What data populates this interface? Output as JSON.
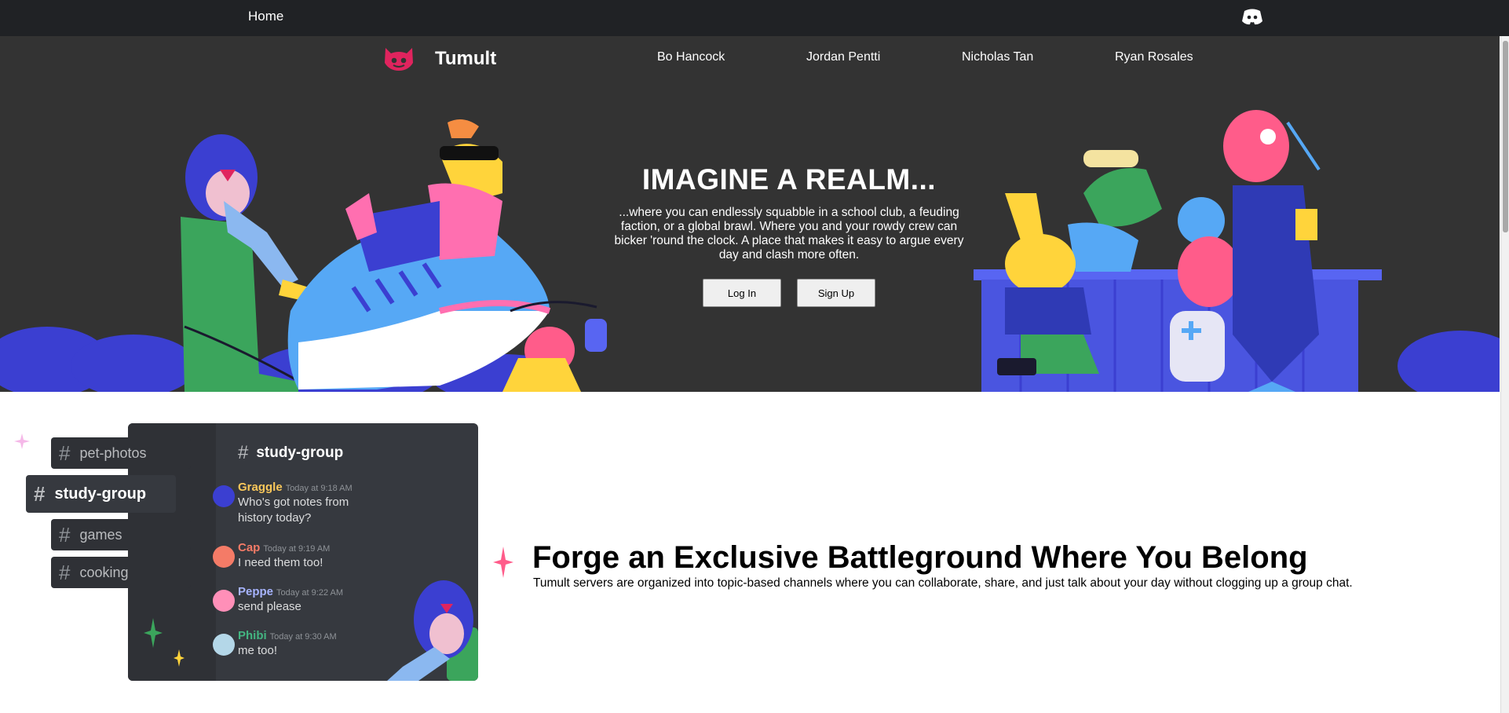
{
  "topbar": {
    "home_label": "Home",
    "right_icon": "discord-icon"
  },
  "brand": {
    "name": "Tumult",
    "logo_icon": "discord-logo-icon",
    "logo_color": "#e0245e"
  },
  "nav": {
    "links": [
      "Bo Hancock",
      "Jordan Pentti",
      "Nicholas Tan",
      "Ryan Rosales"
    ]
  },
  "hero": {
    "title": "IMAGINE A REALM...",
    "text": "...where you can endlessly squabble in a school club, a feuding faction, or a global brawl. Where you and your rowdy crew can bicker 'round the clock. A place that makes it easy to argue every day and clash more often.",
    "login_label": "Log In",
    "signup_label": "Sign Up",
    "background": "#333333",
    "accent_blue": "#5865f2"
  },
  "chat": {
    "channels": [
      "pet-photos",
      "study-group",
      "games",
      "cooking"
    ],
    "active_channel": "study-group",
    "header": "study-group",
    "messages": [
      {
        "name": "Graggle",
        "time": "Today at 9:18 AM",
        "text": "Who's got notes from history today?",
        "color": "#f9c75a"
      },
      {
        "name": "Cap",
        "time": "Today at 9:19 AM",
        "text": "I need them too!",
        "color": "#f47b67"
      },
      {
        "name": "Peppe",
        "time": "Today at 9:22 AM",
        "text": "send please",
        "color": "#a7b4ff"
      },
      {
        "name": "Phibi",
        "time": "Today at 9:30 AM",
        "text": "me too!",
        "color": "#43b581"
      }
    ]
  },
  "feature": {
    "title": "Forge an Exclusive Battleground Where You Belong",
    "text": "Tumult servers are organized into topic-based channels where you can collaborate, share, and just talk about your day without clogging up a group chat."
  }
}
